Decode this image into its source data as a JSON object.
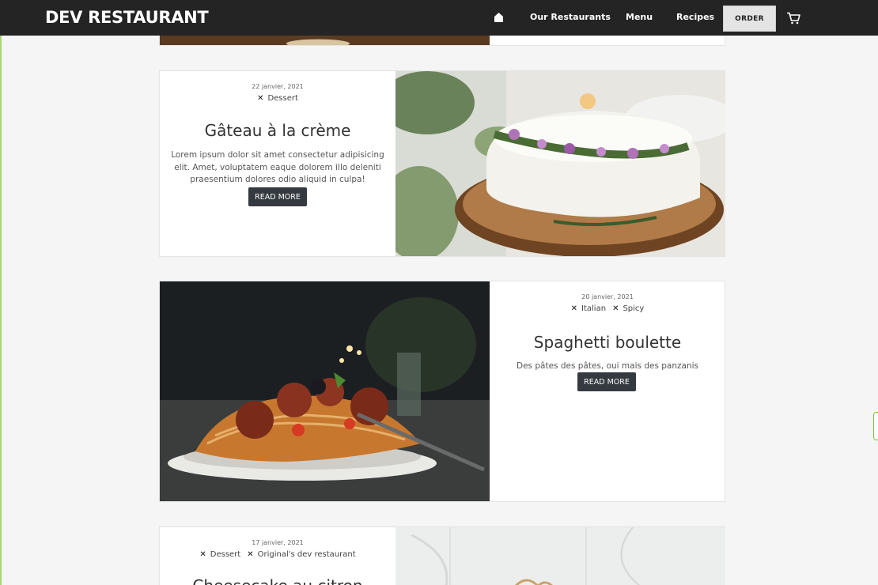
{
  "navbar": {
    "brand": "DEV RESTAURANT",
    "links": [
      "Our Restaurants",
      "Menu",
      "Recipes"
    ],
    "order_label": "ORDER"
  },
  "posts": [
    {
      "date": "22 janvier, 2021",
      "tags": [
        "Dessert"
      ],
      "title": "Gâteau à la crème",
      "description": "Lorem ipsum dolor sit amet consectetur adipisicing elit. Amet, voluptatem eaque dolorem illo deleniti praesentium dolores odio aliquid in culpa!",
      "button": "READ MORE"
    },
    {
      "date": "20 janvier, 2021",
      "tags": [
        "Italian",
        "Spicy"
      ],
      "title": "Spaghetti boulette",
      "description": "Des pâtes des pâtes, oui mais des panzanis",
      "button": "READ MORE"
    },
    {
      "date": "17 janvier, 2021",
      "tags": [
        "Dessert",
        "Original's dev restaurant"
      ],
      "title": "Cheesecake au citron",
      "description": "",
      "button": ""
    }
  ],
  "colors": {
    "navbar_bg": "#242424",
    "page_bg": "#f5f5f5",
    "button_bg": "#343a40",
    "order_bg": "#e4e4e4"
  },
  "icons": {
    "home": "home-icon",
    "cart": "cart-icon",
    "tag_remove": "x-icon"
  }
}
